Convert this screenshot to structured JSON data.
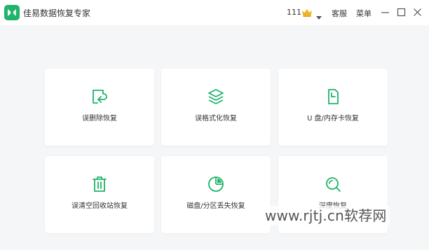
{
  "app": {
    "title": "佳易数据恢复专家"
  },
  "header": {
    "vip_count": "111",
    "customer_service": "客服",
    "menu": "菜单"
  },
  "colors": {
    "accent": "#1fb36b",
    "crown": "#f0b429"
  },
  "cards": [
    {
      "label": "误删除恢复",
      "icon": "recycle-document-icon"
    },
    {
      "label": "误格式化恢复",
      "icon": "layers-icon"
    },
    {
      "label": "U 盘/内存卡恢复",
      "icon": "sd-card-icon"
    },
    {
      "label": "误清空回收站恢复",
      "icon": "trash-icon"
    },
    {
      "label": "磁盘/分区丢失恢复",
      "icon": "pie-partition-icon"
    },
    {
      "label": "深度恢复",
      "icon": "search-icon"
    }
  ],
  "watermark": "www.rjtj.cn软荐网"
}
